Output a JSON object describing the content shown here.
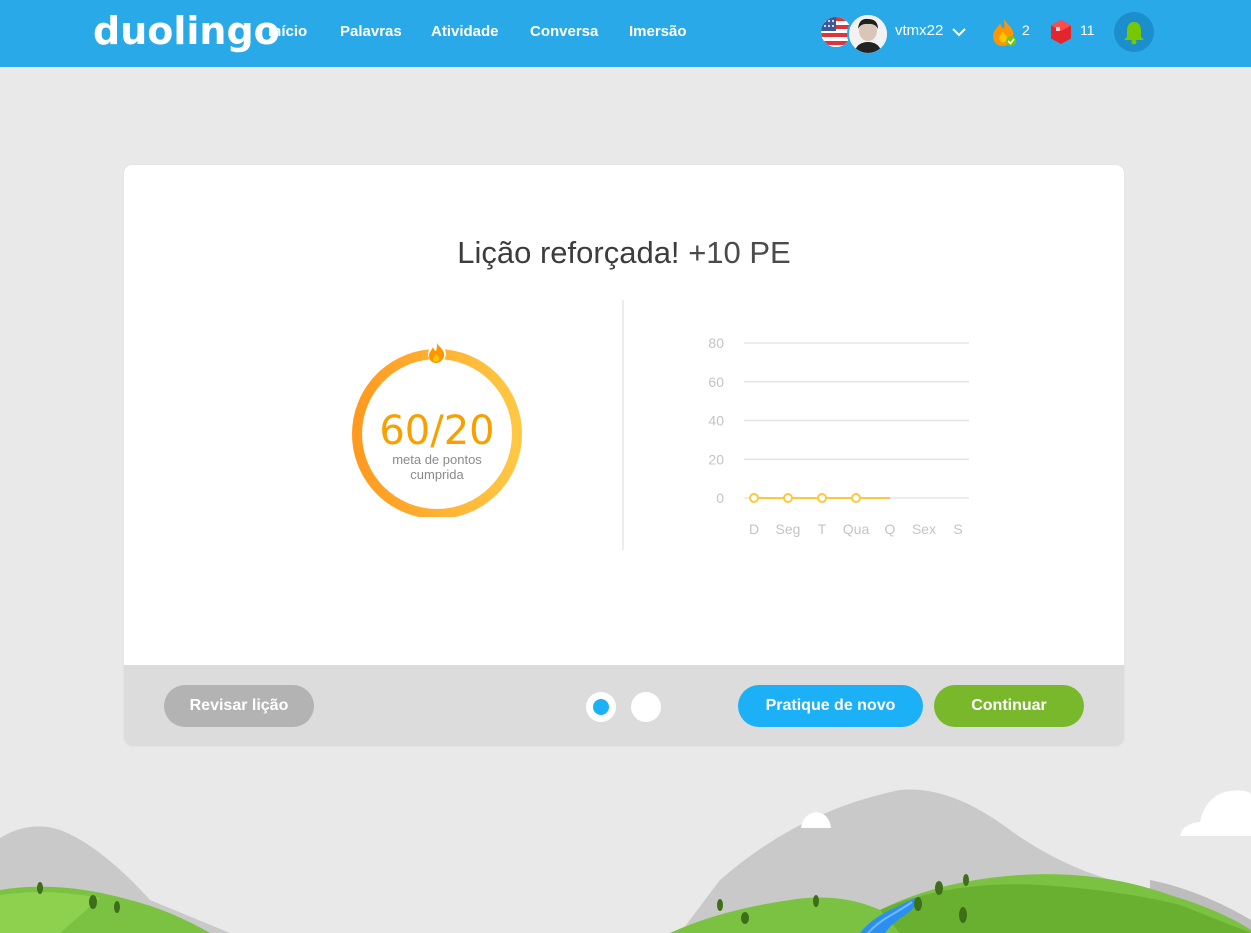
{
  "header": {
    "logo": "duolingo",
    "nav": [
      "Início",
      "Palavras",
      "Atividade",
      "Conversa",
      "Imersão"
    ],
    "username": "vtmx22",
    "streak_count": "2",
    "gems_count": "11"
  },
  "card": {
    "title_main": "Lição reforçada!",
    "title_xp": "+10 PE",
    "goal_value": "60/20",
    "goal_label_line1": "meta de pontos",
    "goal_label_line2": "cumprida",
    "goal_progress": 1.0
  },
  "chart_data": {
    "type": "line",
    "categories": [
      "D",
      "Seg",
      "T",
      "Qua",
      "Q",
      "Sex",
      "S"
    ],
    "values": [
      0,
      0,
      0,
      0,
      null,
      null,
      null
    ],
    "y_ticks": [
      "80",
      "60",
      "40",
      "20",
      "0"
    ],
    "ylim": [
      0,
      80
    ],
    "grid": true,
    "line_color": "#ffc83c"
  },
  "footer": {
    "review_label": "Revisar lição",
    "practice_label": "Pratique de novo",
    "continue_label": "Continuar"
  },
  "colors": {
    "header_bg": "#2aa9e8",
    "accent_orange": "#f7a000",
    "practice_blue": "#1cb0f6",
    "continue_green": "#78b82a"
  }
}
